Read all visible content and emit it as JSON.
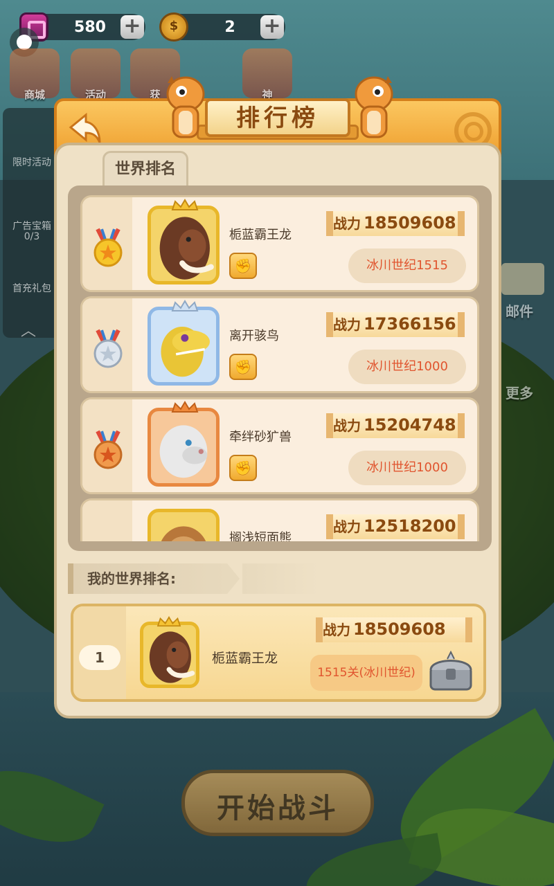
{
  "hud": {
    "gems": "580",
    "coins": "2"
  },
  "top_icons": [
    {
      "label": "商城"
    },
    {
      "label": "活动"
    },
    {
      "label": "获"
    },
    {
      "label": "神"
    }
  ],
  "side_panel": {
    "items": [
      "限时活动",
      "广告宝箱",
      "0/3",
      "首充礼包"
    ]
  },
  "right_labels": {
    "mail": "邮件",
    "more": "更多"
  },
  "dialog": {
    "title": "排行榜",
    "tab_label": "世界排名",
    "rows": [
      {
        "rank_medal": "gold",
        "name": "栀蓝霸王龙",
        "power_label": "战力",
        "power": "18509608",
        "stage": "冰川世纪1515"
      },
      {
        "rank_medal": "silver",
        "name": "离开骇鸟",
        "power_label": "战力",
        "power": "17366156",
        "stage": "冰川世纪1000"
      },
      {
        "rank_medal": "bronze",
        "name": "牵绊砂犷兽",
        "power_label": "战力",
        "power": "15204748",
        "stage": "冰川世纪1000"
      },
      {
        "rank_medal": "none",
        "name": "搁浅短面熊",
        "power_label": "战力",
        "power": "12518200",
        "stage": ""
      }
    ],
    "my_rank_title": "我的世界排名:",
    "my_rank": {
      "rank": "1",
      "name": "栀蓝霸王龙",
      "power_label": "战力",
      "power": "18509608",
      "stage": "1515关(冰川世纪)"
    }
  },
  "start_button": "开始战斗",
  "colors": {
    "accent": "#ee9d2c",
    "stage_text": "#e0542e",
    "panel": "#efe1c6"
  }
}
